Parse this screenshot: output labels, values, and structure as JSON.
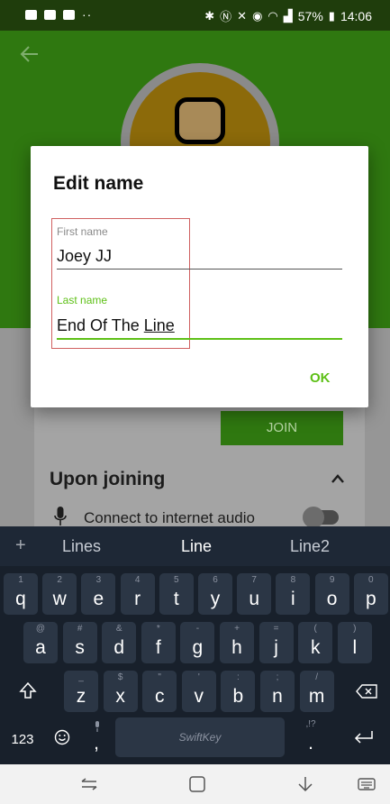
{
  "status_bar": {
    "battery": "57%",
    "time": "14:06",
    "more": "··"
  },
  "screen_behind": {
    "join_label": "JOIN",
    "section_title": "Upon joining",
    "audio_option": "Connect to internet audio"
  },
  "dialog": {
    "title": "Edit name",
    "first_name": {
      "label": "First name",
      "value": "Joey JJ"
    },
    "last_name": {
      "label": "Last name",
      "value_plain": "End Of The ",
      "value_underlined": "Line"
    },
    "ok_label": "OK"
  },
  "keyboard": {
    "suggestions": [
      "Lines",
      "Line",
      "Line2"
    ],
    "add_label": "+",
    "row1": [
      {
        "k": "q",
        "h": "1"
      },
      {
        "k": "w",
        "h": "2"
      },
      {
        "k": "e",
        "h": "3"
      },
      {
        "k": "r",
        "h": "4"
      },
      {
        "k": "t",
        "h": "5"
      },
      {
        "k": "y",
        "h": "6"
      },
      {
        "k": "u",
        "h": "7"
      },
      {
        "k": "i",
        "h": "8"
      },
      {
        "k": "o",
        "h": "9"
      },
      {
        "k": "p",
        "h": "0"
      }
    ],
    "row2": [
      {
        "k": "a",
        "h": "@"
      },
      {
        "k": "s",
        "h": "#"
      },
      {
        "k": "d",
        "h": "&"
      },
      {
        "k": "f",
        "h": "*"
      },
      {
        "k": "g",
        "h": "-"
      },
      {
        "k": "h",
        "h": "+"
      },
      {
        "k": "j",
        "h": "="
      },
      {
        "k": "k",
        "h": "("
      },
      {
        "k": "l",
        "h": ")"
      }
    ],
    "row3": [
      {
        "k": "z",
        "h": "_"
      },
      {
        "k": "x",
        "h": "$"
      },
      {
        "k": "c",
        "h": "\""
      },
      {
        "k": "v",
        "h": "'"
      },
      {
        "k": "b",
        "h": ":"
      },
      {
        "k": "n",
        "h": ";"
      },
      {
        "k": "m",
        "h": "/"
      }
    ],
    "numbers_label": "123",
    "comma_label": ",",
    "period_label": ".",
    "period_hint": ",!?",
    "space_label": "SwiftKey"
  }
}
